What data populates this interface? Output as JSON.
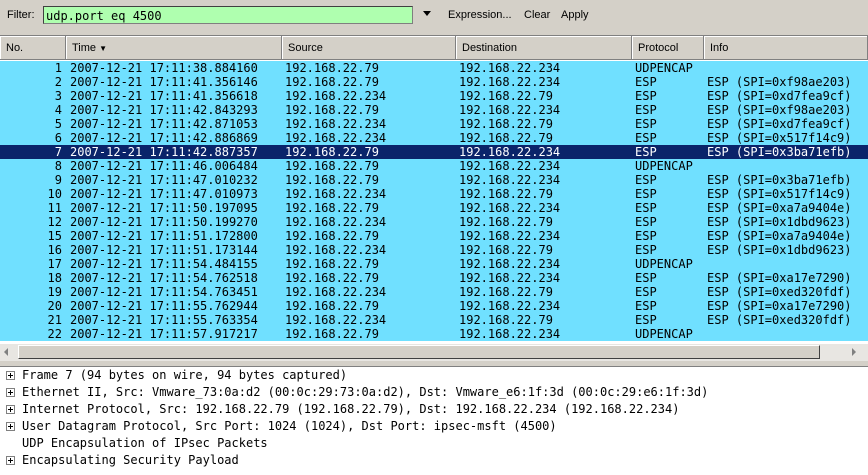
{
  "toolbar": {
    "filter_label": "Filter:",
    "filter_value": "udp.port eq 4500",
    "expression_label": "Expression...",
    "clear_label": "Clear",
    "apply_label": "Apply"
  },
  "columns": [
    "No.",
    "Time",
    "Source",
    "Destination",
    "Protocol",
    "Info"
  ],
  "rows": [
    {
      "no": "1",
      "time": "2007-12-21 17:11:38.884160",
      "src": "192.168.22.79",
      "dst": "192.168.22.234",
      "proto": "UDPENCAP",
      "info": ""
    },
    {
      "no": "2",
      "time": "2007-12-21 17:11:41.356146",
      "src": "192.168.22.79",
      "dst": "192.168.22.234",
      "proto": "ESP",
      "info": "ESP (SPI=0xf98ae203)"
    },
    {
      "no": "3",
      "time": "2007-12-21 17:11:41.356618",
      "src": "192.168.22.234",
      "dst": "192.168.22.79",
      "proto": "ESP",
      "info": "ESP (SPI=0xd7fea9cf)"
    },
    {
      "no": "4",
      "time": "2007-12-21 17:11:42.843293",
      "src": "192.168.22.79",
      "dst": "192.168.22.234",
      "proto": "ESP",
      "info": "ESP (SPI=0xf98ae203)"
    },
    {
      "no": "5",
      "time": "2007-12-21 17:11:42.871053",
      "src": "192.168.22.234",
      "dst": "192.168.22.79",
      "proto": "ESP",
      "info": "ESP (SPI=0xd7fea9cf)"
    },
    {
      "no": "6",
      "time": "2007-12-21 17:11:42.886869",
      "src": "192.168.22.234",
      "dst": "192.168.22.79",
      "proto": "ESP",
      "info": "ESP (SPI=0x517f14c9)"
    },
    {
      "no": "7",
      "time": "2007-12-21 17:11:42.887357",
      "src": "192.168.22.79",
      "dst": "192.168.22.234",
      "proto": "ESP",
      "info": "ESP (SPI=0x3ba71efb)"
    },
    {
      "no": "8",
      "time": "2007-12-21 17:11:46.006484",
      "src": "192.168.22.79",
      "dst": "192.168.22.234",
      "proto": "UDPENCAP",
      "info": ""
    },
    {
      "no": "9",
      "time": "2007-12-21 17:11:47.010232",
      "src": "192.168.22.79",
      "dst": "192.168.22.234",
      "proto": "ESP",
      "info": "ESP (SPI=0x3ba71efb)"
    },
    {
      "no": "10",
      "time": "2007-12-21 17:11:47.010973",
      "src": "192.168.22.234",
      "dst": "192.168.22.79",
      "proto": "ESP",
      "info": "ESP (SPI=0x517f14c9)"
    },
    {
      "no": "11",
      "time": "2007-12-21 17:11:50.197095",
      "src": "192.168.22.79",
      "dst": "192.168.22.234",
      "proto": "ESP",
      "info": "ESP (SPI=0xa7a9404e)"
    },
    {
      "no": "12",
      "time": "2007-12-21 17:11:50.199270",
      "src": "192.168.22.234",
      "dst": "192.168.22.79",
      "proto": "ESP",
      "info": "ESP (SPI=0x1dbd9623)"
    },
    {
      "no": "15",
      "time": "2007-12-21 17:11:51.172800",
      "src": "192.168.22.79",
      "dst": "192.168.22.234",
      "proto": "ESP",
      "info": "ESP (SPI=0xa7a9404e)"
    },
    {
      "no": "16",
      "time": "2007-12-21 17:11:51.173144",
      "src": "192.168.22.234",
      "dst": "192.168.22.79",
      "proto": "ESP",
      "info": "ESP (SPI=0x1dbd9623)"
    },
    {
      "no": "17",
      "time": "2007-12-21 17:11:54.484155",
      "src": "192.168.22.79",
      "dst": "192.168.22.234",
      "proto": "UDPENCAP",
      "info": ""
    },
    {
      "no": "18",
      "time": "2007-12-21 17:11:54.762518",
      "src": "192.168.22.79",
      "dst": "192.168.22.234",
      "proto": "ESP",
      "info": "ESP (SPI=0xa17e7290)"
    },
    {
      "no": "19",
      "time": "2007-12-21 17:11:54.763451",
      "src": "192.168.22.234",
      "dst": "192.168.22.79",
      "proto": "ESP",
      "info": "ESP (SPI=0xed320fdf)"
    },
    {
      "no": "20",
      "time": "2007-12-21 17:11:55.762944",
      "src": "192.168.22.79",
      "dst": "192.168.22.234",
      "proto": "ESP",
      "info": "ESP (SPI=0xa17e7290)"
    },
    {
      "no": "21",
      "time": "2007-12-21 17:11:55.763354",
      "src": "192.168.22.234",
      "dst": "192.168.22.79",
      "proto": "ESP",
      "info": "ESP (SPI=0xed320fdf)"
    },
    {
      "no": "22",
      "time": "2007-12-21 17:11:57.917217",
      "src": "192.168.22.79",
      "dst": "192.168.22.234",
      "proto": "UDPENCAP",
      "info": ""
    }
  ],
  "selected_row_no": "7",
  "details": [
    {
      "text": "Frame 7 (94 bytes on wire, 94 bytes captured)",
      "expandable": true
    },
    {
      "text": "Ethernet II, Src: Vmware_73:0a:d2 (00:0c:29:73:0a:d2), Dst: Vmware_e6:1f:3d (00:0c:29:e6:1f:3d)",
      "expandable": true
    },
    {
      "text": "Internet Protocol, Src: 192.168.22.79 (192.168.22.79), Dst: 192.168.22.234 (192.168.22.234)",
      "expandable": true
    },
    {
      "text": "User Datagram Protocol, Src Port: 1024 (1024), Dst Port: ipsec-msft (4500)",
      "expandable": true
    },
    {
      "text": "UDP Encapsulation of IPsec Packets",
      "expandable": false
    },
    {
      "text": "Encapsulating Security Payload",
      "expandable": true
    }
  ],
  "colors": {
    "row_bg": "#70e0ff",
    "selected_bg": "#0a246a",
    "filter_bg": "#afffaf"
  }
}
